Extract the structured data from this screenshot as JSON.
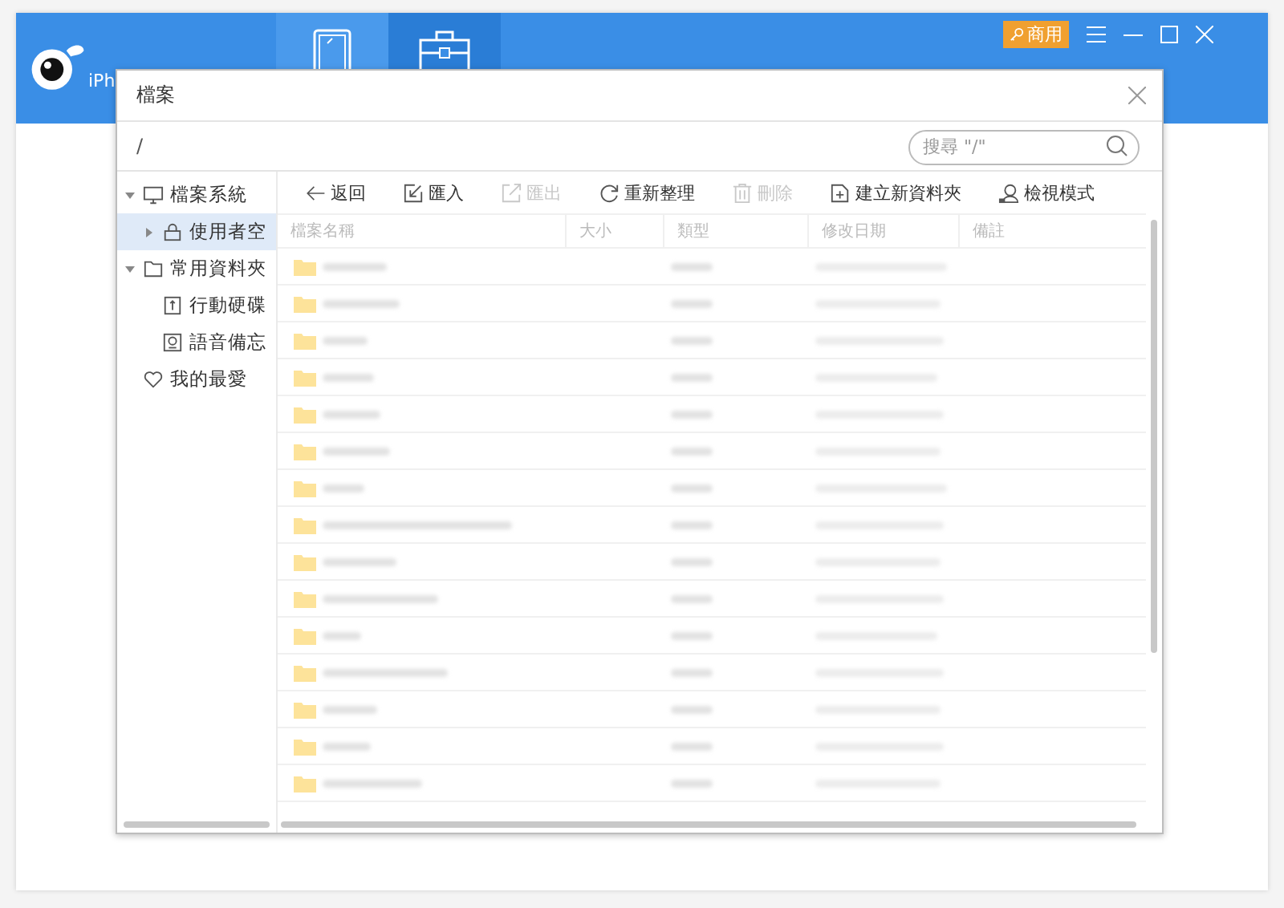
{
  "app": {
    "name": "iPh",
    "badge": "商用",
    "tabs": [
      {
        "kind": "phone",
        "selected": false
      },
      {
        "kind": "toolbox",
        "selected": true
      }
    ]
  },
  "dialog": {
    "title": "檔案",
    "path": "/",
    "search": {
      "placeholder": "搜尋 \"/\""
    },
    "tree": [
      {
        "label": "檔案系統",
        "kind": "computer",
        "expanded": true,
        "selected": false,
        "children": [
          {
            "label": "使用者空",
            "kind": "lock",
            "expanded": false,
            "selected": true
          }
        ]
      },
      {
        "label": "常用資料夾",
        "kind": "folder",
        "expanded": true,
        "selected": false,
        "children": [
          {
            "label": "行動硬碟",
            "kind": "drive",
            "selected": false
          },
          {
            "label": "語音備忘",
            "kind": "voice",
            "selected": false
          }
        ]
      },
      {
        "label": "我的最愛",
        "kind": "heart",
        "selected": false
      }
    ],
    "toolbar": [
      {
        "label": "返回",
        "kind": "back",
        "disabled": false
      },
      {
        "label": "匯入",
        "kind": "import",
        "disabled": false
      },
      {
        "label": "匯出",
        "kind": "export",
        "disabled": true
      },
      {
        "label": "重新整理",
        "kind": "refresh",
        "disabled": false
      },
      {
        "label": "刪除",
        "kind": "trash",
        "disabled": true
      },
      {
        "label": "建立新資料夾",
        "kind": "newfolder",
        "disabled": false
      },
      {
        "label": "檢視模式",
        "kind": "view",
        "disabled": false
      }
    ],
    "columns": [
      "檔案名稱",
      "大小",
      "類型",
      "修改日期",
      "備註"
    ],
    "rows": [
      {
        "kind": "folder"
      },
      {
        "kind": "folder"
      },
      {
        "kind": "folder"
      },
      {
        "kind": "folder"
      },
      {
        "kind": "folder"
      },
      {
        "kind": "folder"
      },
      {
        "kind": "folder"
      },
      {
        "kind": "folder"
      },
      {
        "kind": "folder"
      },
      {
        "kind": "folder"
      },
      {
        "kind": "folder"
      },
      {
        "kind": "folder"
      },
      {
        "kind": "folder"
      },
      {
        "kind": "folder"
      },
      {
        "kind": "folder"
      }
    ]
  }
}
